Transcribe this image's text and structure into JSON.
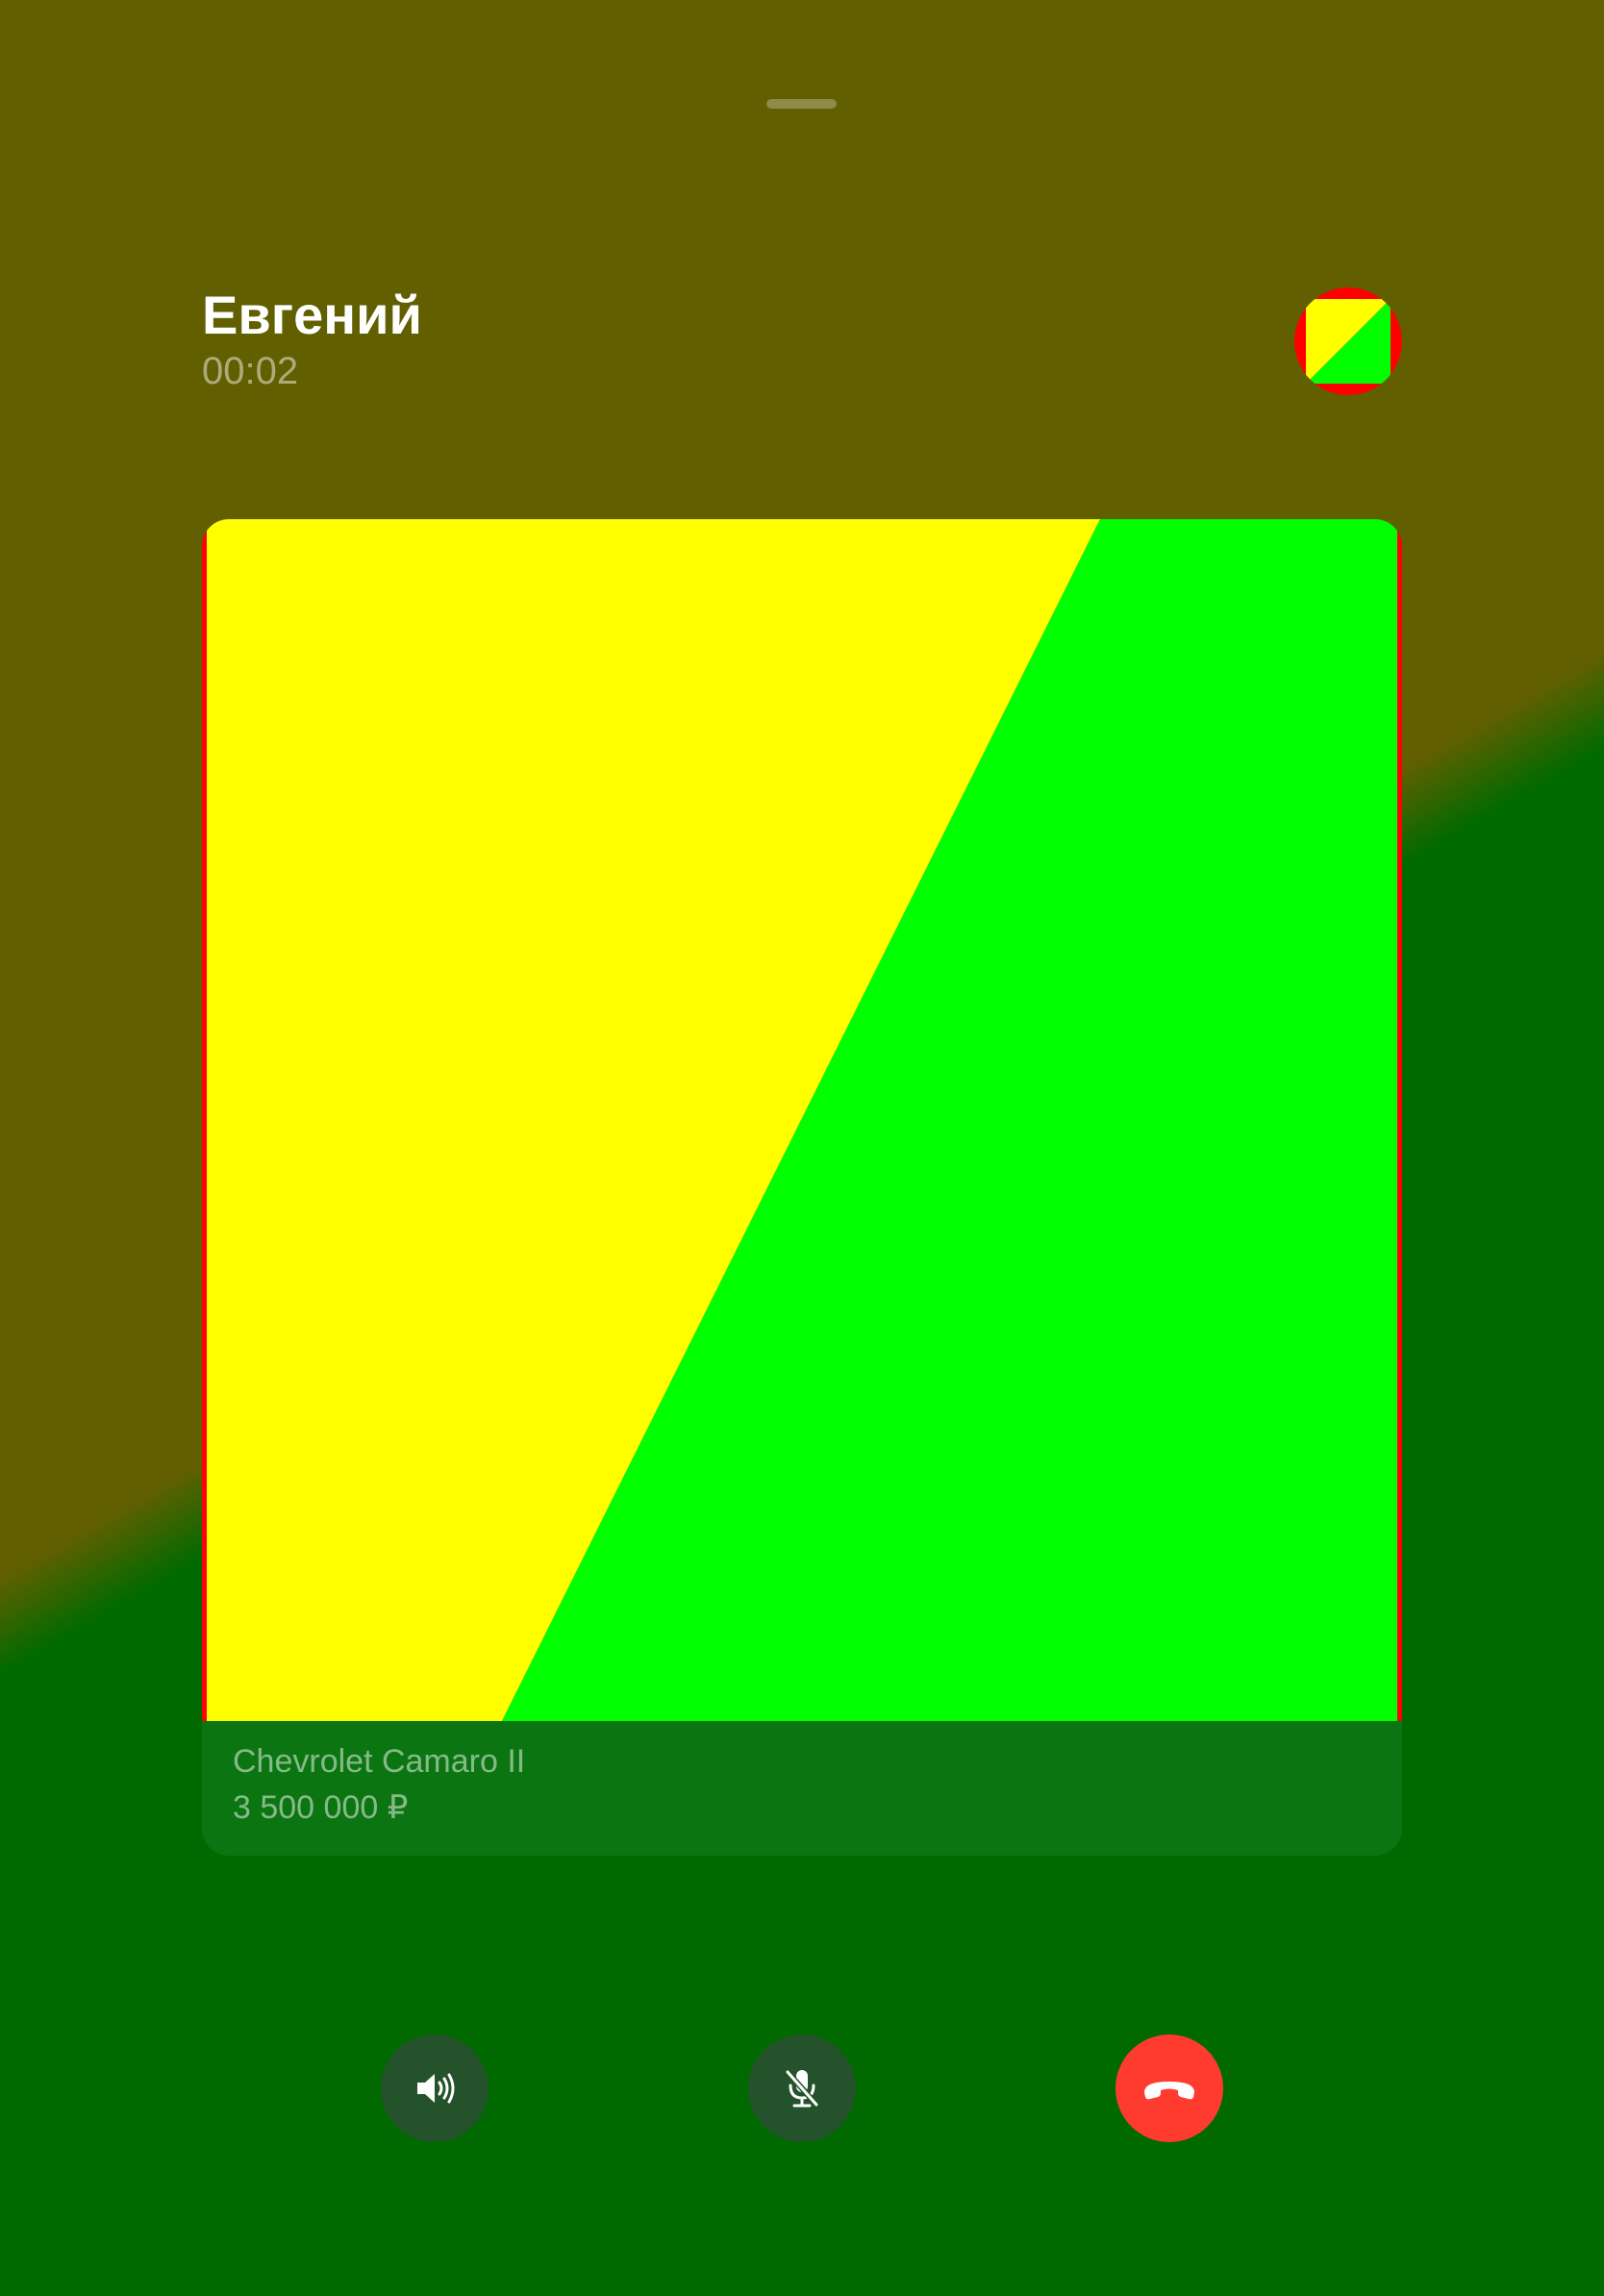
{
  "caller": {
    "name": "Евгений",
    "duration": "00:02",
    "avatar": "contact-avatar"
  },
  "listing": {
    "title": "Chevrolet Camaro II",
    "price": "3 500 000 ₽"
  },
  "controls": {
    "speaker_icon": "speaker-icon",
    "mute_icon": "microphone-off-icon",
    "end_call_icon": "phone-hangup-icon"
  },
  "colors": {
    "background_top": "#615f00",
    "background_bottom": "#006a00",
    "end_call": "#ff3b30",
    "control_button": "#24522a",
    "image_yellow": "#ffff00",
    "image_green": "#00ff00",
    "image_border": "#ff0000"
  }
}
